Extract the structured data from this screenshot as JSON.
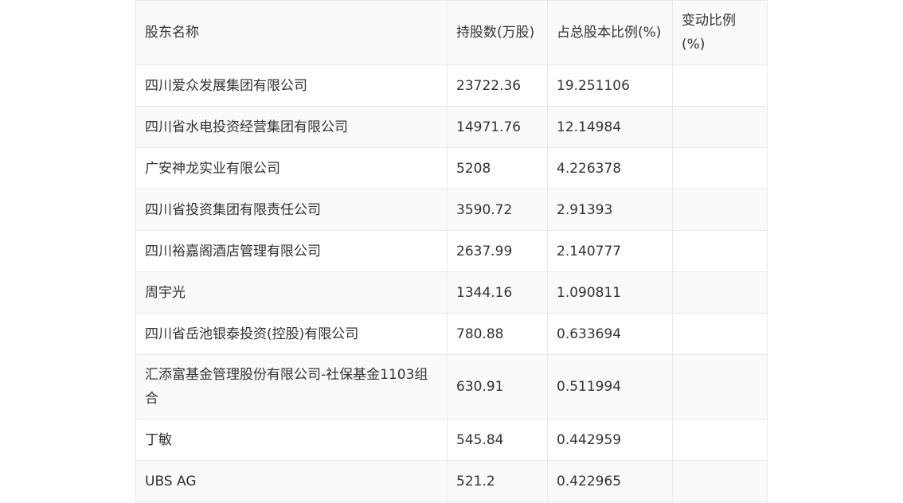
{
  "table": {
    "headers": [
      "股东名称",
      "持股数(万股)",
      "占总股本比例(%)",
      "变动比例(%)"
    ],
    "rows": [
      [
        "四川爱众发展集团有限公司",
        "23722.36",
        "19.251106",
        ""
      ],
      [
        "四川省水电投资经营集团有限公司",
        "14971.76",
        "12.14984",
        ""
      ],
      [
        "广安神龙实业有限公司",
        "5208",
        "4.226378",
        ""
      ],
      [
        "四川省投资集团有限责任公司",
        "3590.72",
        "2.91393",
        ""
      ],
      [
        "四川裕嘉阁酒店管理有限公司",
        "2637.99",
        "2.140777",
        ""
      ],
      [
        "周宇光",
        "1344.16",
        "1.090811",
        ""
      ],
      [
        "四川省岳池银泰投资(控股)有限公司",
        "780.88",
        "0.633694",
        ""
      ],
      [
        "汇添富基金管理股份有限公司-社保基金1103组合",
        "630.91",
        "0.511994",
        ""
      ],
      [
        "丁敏",
        "545.84",
        "0.442959",
        ""
      ],
      [
        "UBS AG",
        "521.2",
        "0.422965",
        ""
      ]
    ]
  }
}
